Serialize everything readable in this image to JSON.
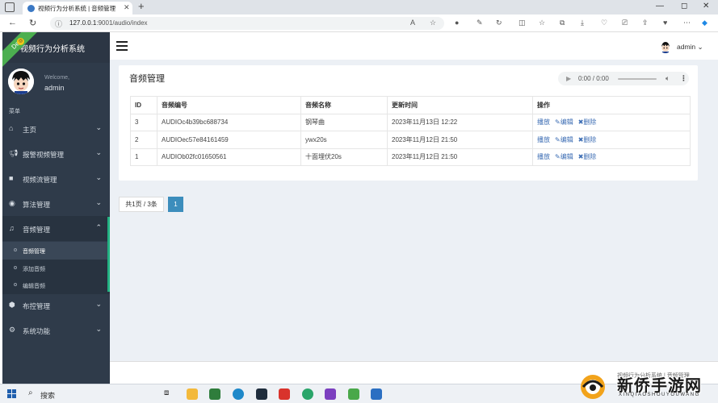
{
  "browser": {
    "tab_title": "视频行为分析系统 | 音频管理",
    "url_host": "127.0.0.1",
    "url_rest": ":9001/audio/index"
  },
  "sidebar": {
    "brand": "视频行为分析系统",
    "dev_badge": "Dev",
    "welcome": "Welcome,",
    "username": "admin",
    "menu_header": "菜单",
    "items": [
      {
        "label": "主页",
        "icon": "home-icon"
      },
      {
        "label": "报警视频管理",
        "icon": "bullhorn-icon"
      },
      {
        "label": "视频流管理",
        "icon": "video-camera-icon"
      },
      {
        "label": "算法管理",
        "icon": "eye-icon"
      },
      {
        "label": "音频管理",
        "icon": "music-icon"
      },
      {
        "label": "布控管理",
        "icon": "cube-icon"
      },
      {
        "label": "系统功能",
        "icon": "gear-icon"
      }
    ],
    "sub_items": [
      {
        "label": "音频管理"
      },
      {
        "label": "添加音频"
      },
      {
        "label": "编辑音频"
      }
    ]
  },
  "topbar": {
    "user": "admin"
  },
  "panel": {
    "title": "音频管理",
    "player_time": "0:00 / 0:00"
  },
  "table": {
    "headers": [
      "ID",
      "音频编号",
      "音频名称",
      "更新时间",
      "操作"
    ],
    "rows": [
      {
        "id": "3",
        "code": "AUDIOc4b39bc688734",
        "name": "钢琴曲",
        "time": "2023年11月13日 12:22"
      },
      {
        "id": "2",
        "code": "AUDIOec57e84161459",
        "name": "ywx20s",
        "time": "2023年11月12日 21:50"
      },
      {
        "id": "1",
        "code": "AUDIOb02fc01650561",
        "name": "十面埋伏20s",
        "time": "2023年11月12日 21:50"
      }
    ],
    "actions": {
      "play": "播放",
      "edit": "编辑",
      "delete": "删除"
    }
  },
  "pager": {
    "info": "共1页 / 3条",
    "current": "1"
  },
  "footer": {
    "text": "视频行为分析系统 | 音频管理"
  },
  "taskbar": {
    "search": "搜索"
  },
  "watermark": {
    "text": "新侨手游网",
    "sub": "XINQIAOSHOUYOUWANG"
  },
  "colors": {
    "sidebar_bg": "#2f3b4a",
    "accent_green": "#23b383",
    "pager_blue": "#3c8dbc",
    "link_blue": "#3c6db4"
  }
}
